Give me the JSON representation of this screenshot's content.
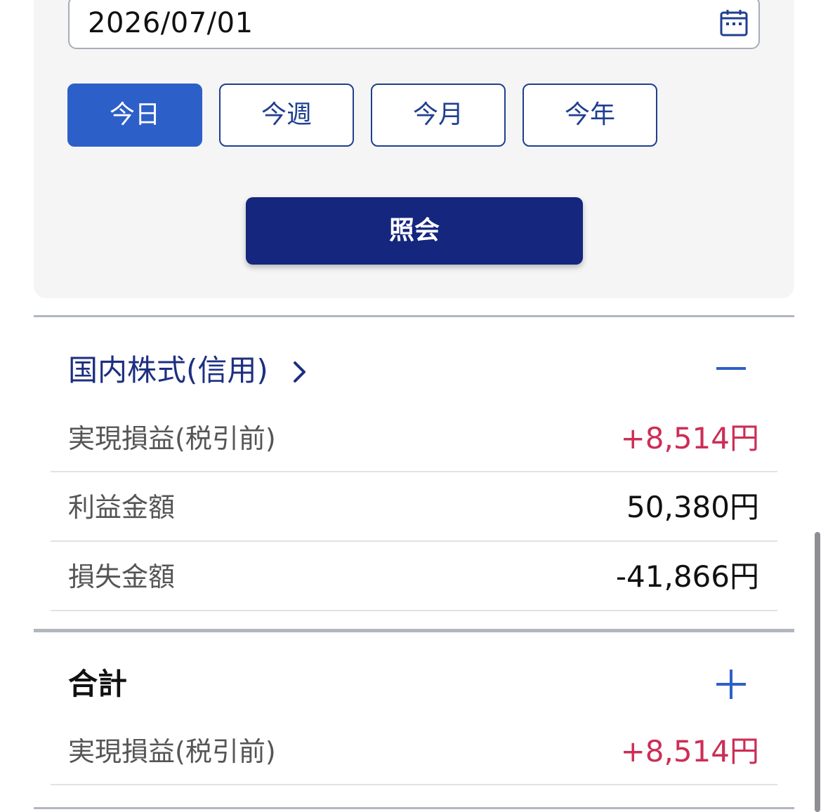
{
  "search": {
    "date_value": "2026/07/01"
  },
  "period_buttons": {
    "today": "今日",
    "this_week": "今週",
    "this_month": "今月",
    "this_year": "今年",
    "selected": "今日"
  },
  "submit": {
    "label": "照会"
  },
  "domestic_margin": {
    "title": "国内株式(信用)",
    "rows": [
      {
        "label": "実現損益(税引前)",
        "value": "+8,514円"
      },
      {
        "label": "利益金額",
        "value": "50,380円"
      },
      {
        "label": "損失金額",
        "value": "-41,866円"
      }
    ]
  },
  "total": {
    "title": "合計",
    "rows": [
      {
        "label": "実現損益(税引前)",
        "value": "+8,514円"
      }
    ]
  },
  "colors": {
    "accent_blue": "#2d5fc8",
    "navy": "#14267e",
    "positive_red": "#cc2e56"
  },
  "icons": {
    "date_picker": "calendar-icon",
    "section_link": "chevron-right-icon",
    "collapse": "minus-icon",
    "expand": "plus-icon"
  }
}
